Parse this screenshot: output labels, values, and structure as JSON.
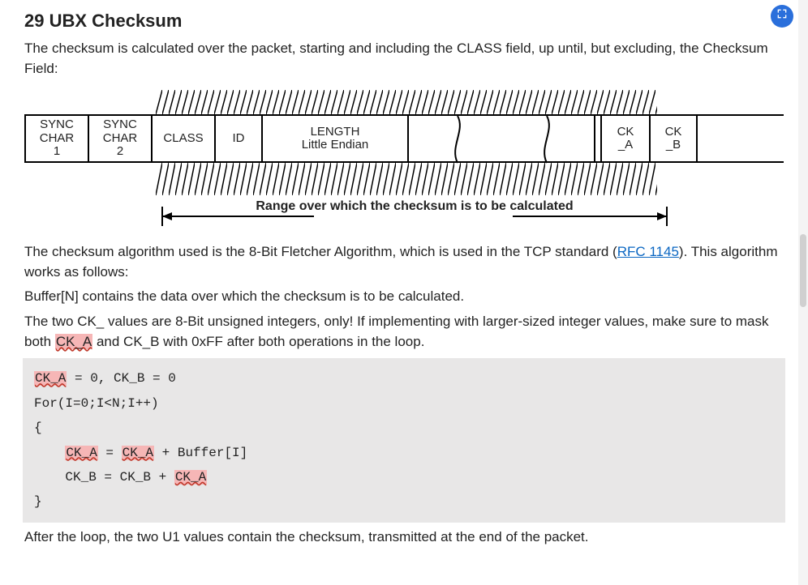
{
  "heading": "29 UBX Checksum",
  "intro": "The checksum is calculated over the packet, starting and including the CLASS field, up until, but excluding, the Checksum Field:",
  "packet": {
    "sync1": "SYNC\nCHAR\n1",
    "sync2": "SYNC\nCHAR\n2",
    "class": "CLASS",
    "id": "ID",
    "length": "LENGTH\nLittle Endian",
    "cka": "CK\n_A",
    "ckb": "CK\n_B"
  },
  "range_label": "Range over which the\nchecksum is to be calculated",
  "para_algo_pre": "The checksum algorithm used is the 8-Bit Fletcher Algorithm, which is used in the TCP standard (",
  "rfc_text": "RFC 1145",
  "para_algo_post": "). This algorithm works as follows:",
  "para_buffer": "Buffer[N] contains the data over which the checksum is to be calculated.",
  "para_ck_pre": "The two CK_ values are 8-Bit unsigned integers, only! If implementing with larger-sized integer values, make sure to mask both ",
  "ck_a_hl": "CK_A",
  "para_ck_post": " and CK_B with 0xFF after both operations in the loop.",
  "code": {
    "l1a": "CK_A",
    "l1b": " = 0, CK_B = 0",
    "l2": "For(I=0;I<N;I++)",
    "l3": "{",
    "l4a": "    ",
    "l4b": "CK_A",
    "l4c": " = ",
    "l4d": "CK_A",
    "l4e": " + Buffer[I]",
    "l5a": "    CK_B = CK_B + ",
    "l5b": "CK_A",
    "l6": "}"
  },
  "para_after": "After the loop, the two U1 values contain the checksum, transmitted at the end of the packet."
}
